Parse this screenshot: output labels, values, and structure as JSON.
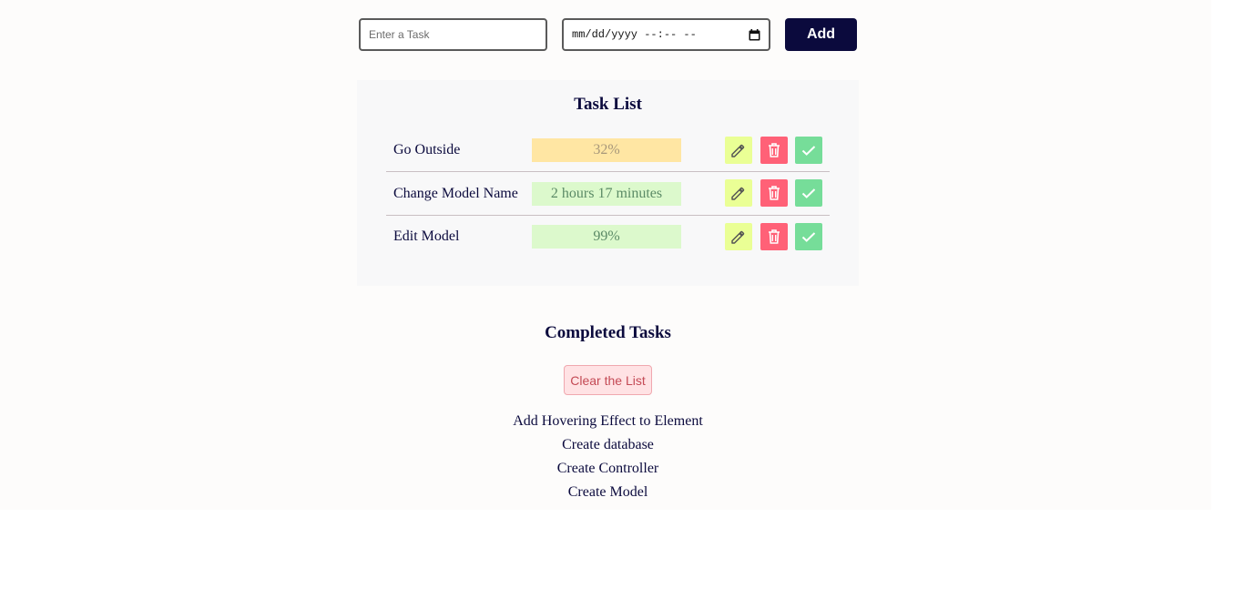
{
  "form": {
    "task_placeholder": "Enter a Task",
    "date_placeholder": "mm/dd/yyyy --:-- --",
    "add_label": "Add"
  },
  "task_list": {
    "title": "Task List",
    "tasks": [
      {
        "name": "Go Outside",
        "status": "32%",
        "status_color": "#ffe6a3"
      },
      {
        "name": "Change Model Name",
        "status": "2 hours 17 minutes",
        "status_color": "#dcf9cc"
      },
      {
        "name": "Edit Model",
        "status": "99%",
        "status_color": "#dcf9cc"
      }
    ],
    "actions": {
      "edit_icon": "pencil-icon",
      "delete_icon": "trash-icon",
      "complete_icon": "checkmark-icon"
    }
  },
  "completed": {
    "title": "Completed Tasks",
    "clear_label": "Clear the List",
    "items": [
      "Add Hovering Effect to Element",
      "Create database",
      "Create Controller",
      "Create Model"
    ]
  },
  "colors": {
    "primary": "#0b0a3d",
    "edit": "#eaff95",
    "delete": "#ff6177",
    "complete": "#76dd99"
  }
}
